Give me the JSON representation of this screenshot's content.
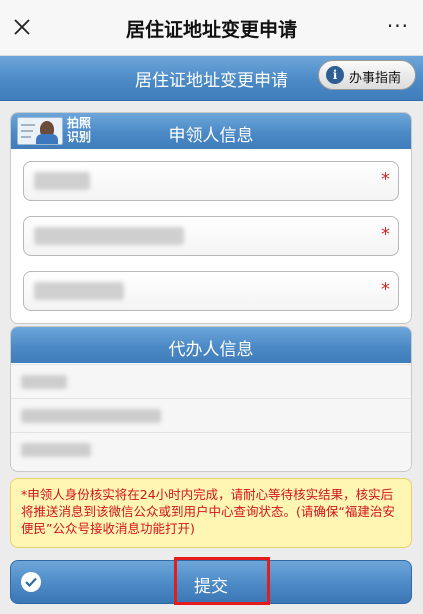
{
  "topbar": {
    "title": "居住证地址变更申请",
    "more_label": "···"
  },
  "header": {
    "title": "居住证地址变更申请",
    "guide_label": "办事指南",
    "guide_icon_text": "i"
  },
  "applicant_section": {
    "title": "申领人信息",
    "photo_button_label": "拍照识别",
    "fields": [
      {
        "value": "",
        "required_mark": "*"
      },
      {
        "value": "",
        "required_mark": "*"
      },
      {
        "value": "",
        "required_mark": "*"
      }
    ]
  },
  "agent_section": {
    "title": "代办人信息",
    "rows": [
      {
        "value": ""
      },
      {
        "value": ""
      },
      {
        "value": ""
      }
    ]
  },
  "notice": {
    "text": "*申领人身份核实将在24小时内完成，请耐心等待核实结果，核实后将推送消息到该微信公众或到用户中心查询状态。(请确保“福建治安便民”公众号接收消息功能打开)"
  },
  "submit": {
    "label": "提交"
  },
  "colors": {
    "header_blue": "#4c8ac6",
    "notice_bg": "#fff6b3",
    "notice_text": "#d2141e",
    "highlight_red": "#e51c1c"
  }
}
